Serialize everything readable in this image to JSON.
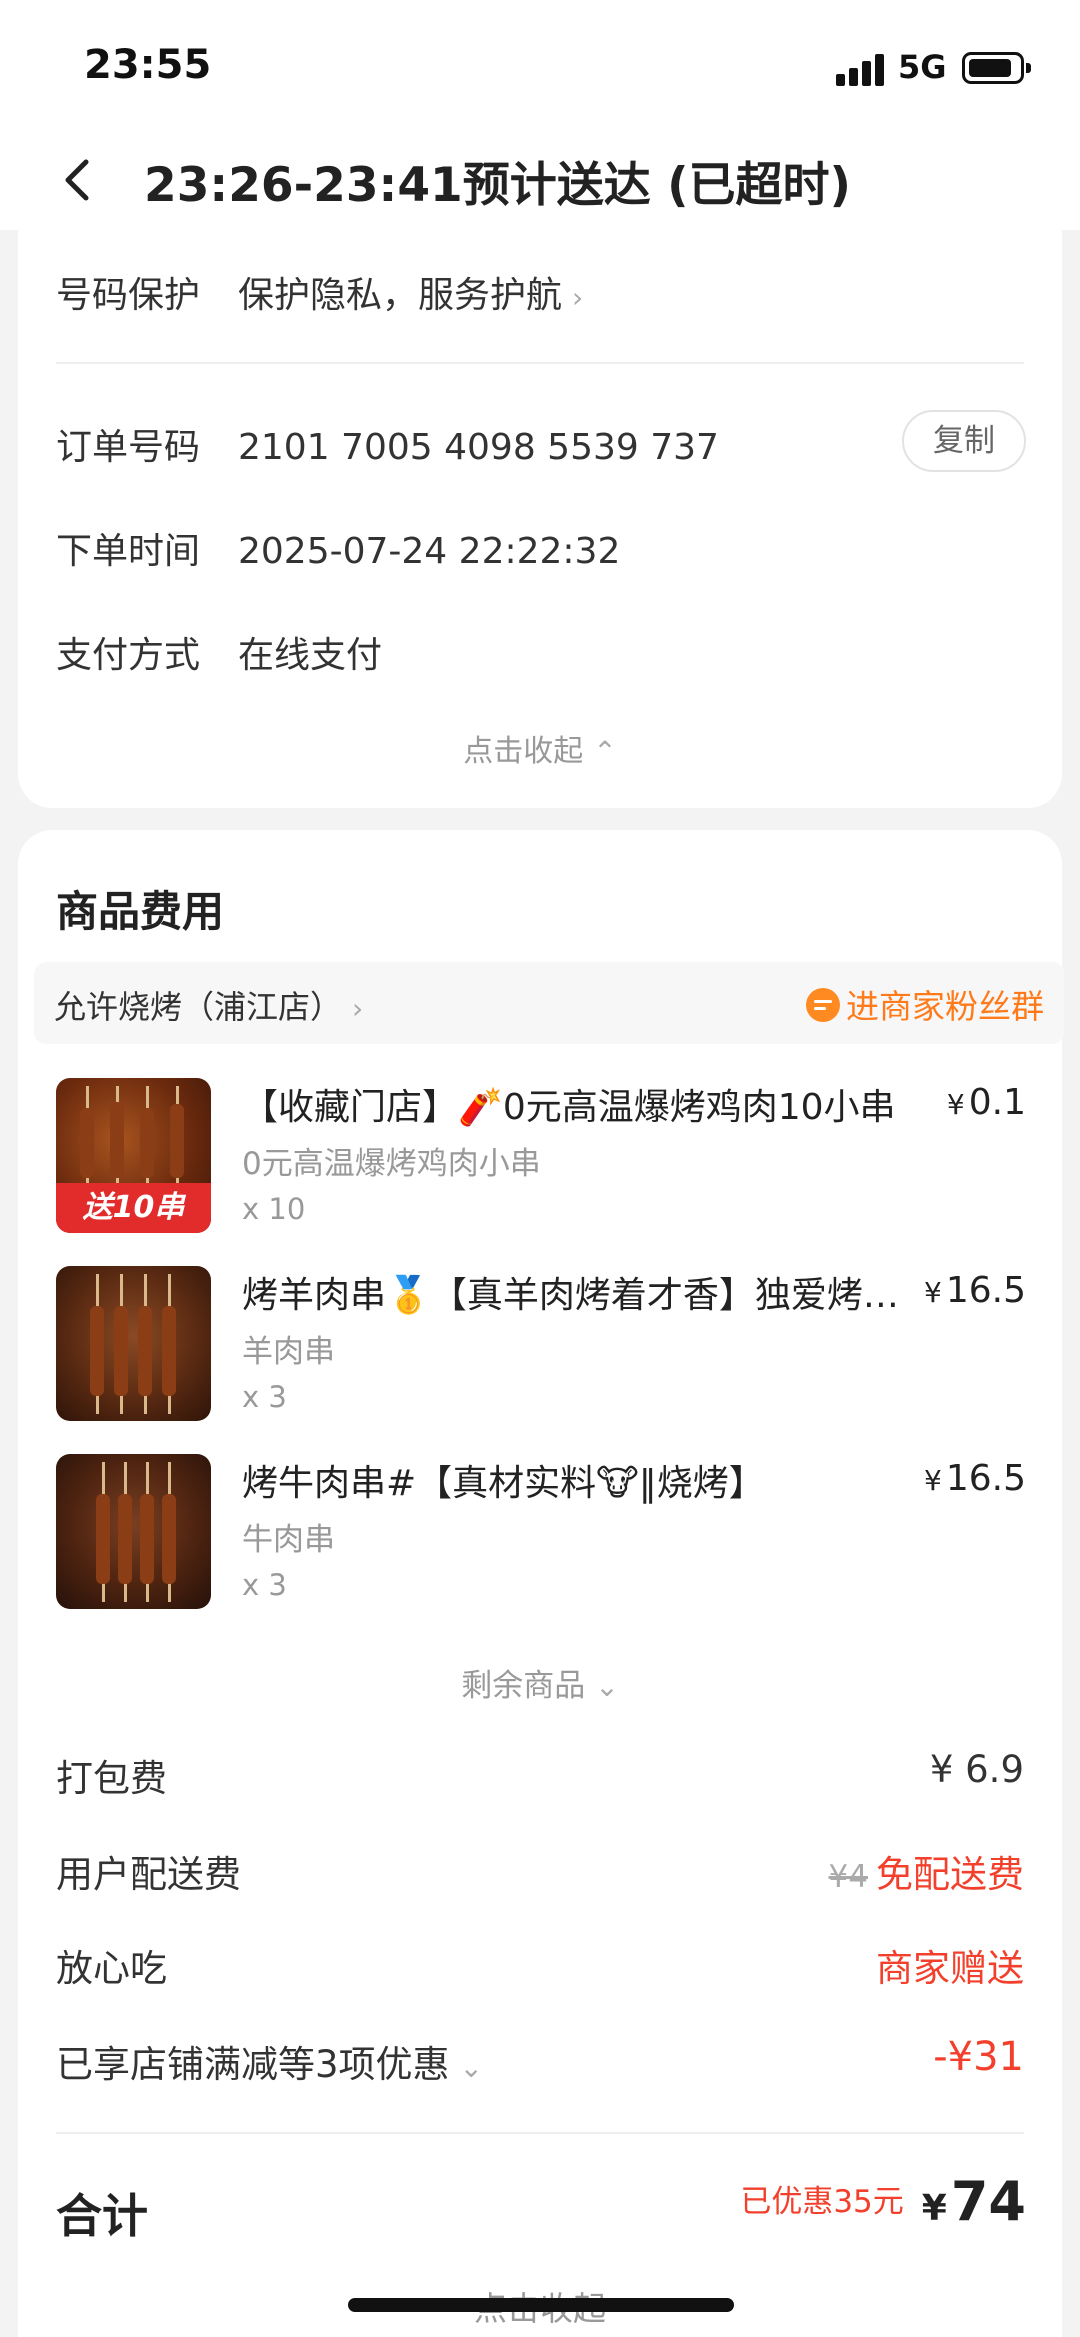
{
  "status": {
    "time": "23:55",
    "network": "5G"
  },
  "nav": {
    "title": "23:26-23:41预计送达 (已超时)"
  },
  "order_info": {
    "privacy": {
      "label": "号码保护",
      "value": "保护隐私，服务护航"
    },
    "order_no": {
      "label": "订单号码",
      "value": "2101 7005 4098 5539 737",
      "copy_label": "复制"
    },
    "order_time": {
      "label": "下单时间",
      "value": "2025-07-24 22:22:32"
    },
    "payment": {
      "label": "支付方式",
      "value": "在线支付"
    },
    "collapse_label": "点击收起"
  },
  "goods": {
    "title": "商品费用",
    "shop_name": "允许烧烤（浦江店）",
    "fans_label": "进商家粉丝群",
    "items": [
      {
        "title": "【收藏门店】🧨0元高温爆烤鸡肉10小串",
        "price": "0.1",
        "sub": "0元高温爆烤鸡肉小串",
        "qty": "x 10",
        "promo": "送10串"
      },
      {
        "title": "烤羊肉串🥇【真羊肉烤着才香】独爱烤羊肉串",
        "price": "16.5",
        "sub": "羊肉串",
        "qty": "x 3"
      },
      {
        "title": "烤牛肉串#【真材实料🐮‖烧烤】",
        "price": "16.5",
        "sub": "牛肉串",
        "qty": "x 3"
      }
    ],
    "more_label": "剩余商品",
    "currency": "¥"
  },
  "fees": {
    "packing": {
      "label": "打包费",
      "value": "¥ 6.9"
    },
    "delivery": {
      "label": "用户配送费",
      "original": "¥4",
      "value": "免配送费"
    },
    "safe_eat": {
      "label": "放心吃",
      "value": "商家赠送"
    },
    "discount": {
      "label": "已享店铺满减等3项优惠",
      "value": "-¥31"
    }
  },
  "total": {
    "label": "合计",
    "saved": "已优惠35元",
    "amount": "74"
  },
  "footer": {
    "collapse_label": "点击收起"
  },
  "colors": {
    "accent_red": "#f2402c",
    "fans_orange": "#ff7a1a"
  }
}
